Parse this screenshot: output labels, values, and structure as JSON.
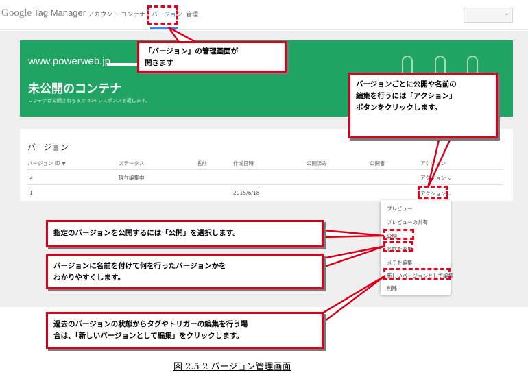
{
  "app": {
    "logo_google": "Google",
    "logo_product": "Tag Manager"
  },
  "nav": {
    "account": "アカウント",
    "container": "コンテナ",
    "versions": "バージョン",
    "admin": "管理"
  },
  "account_select": {
    "chevron": "⌄"
  },
  "hero": {
    "domain": "www.powerweb.jp",
    "title": "未公開のコンテナ",
    "subtitle": "コンテナは公開されるまで 404 レスポンスを返します。"
  },
  "versions": {
    "title": "バージョン",
    "columns": [
      "バージョン ID ▼",
      "ステータス",
      "名前",
      "作成日時",
      "公開済み",
      "公開者",
      "アクション"
    ],
    "rows": [
      {
        "id": "2",
        "status": "現在編集中",
        "name": "",
        "created": "",
        "published": "",
        "publisher": "",
        "action": "アクション ⌄"
      },
      {
        "id": "1",
        "status": "",
        "name": "",
        "created": "2015/6/18",
        "published": "",
        "publisher": "",
        "action": "アクション ⌄"
      }
    ]
  },
  "action_menu": {
    "items": [
      "プレビュー",
      "プレビューの共有",
      "公開",
      "名前を変更",
      "メモを編集",
      "新しいバージョンとして編集",
      "削除"
    ]
  },
  "callouts": {
    "versions_screen": [
      "「バージョン」の管理画面が",
      "開きます"
    ],
    "action_button": [
      "バージョンごとに公開や名前の",
      "編集を行うには「アクション」",
      "ボタンをクリックします。"
    ],
    "publish": [
      "指定のバージョンを公開するには「公開」を選択します。"
    ],
    "rename": [
      "バージョンに名前を付けて何を行ったバージョンかを",
      "わかりやすくします。"
    ],
    "edit_new": [
      "過去のバージョンの状態からタグやトリガーの編集を行う場",
      "合は、「新しいバージョンとして編集」をクリックします。"
    ]
  },
  "caption": "図 2.5-2 バージョン管理画面",
  "colors": {
    "green": "#1fa463",
    "nav_active": "#4285f4",
    "highlight_red": "#e8001c"
  }
}
